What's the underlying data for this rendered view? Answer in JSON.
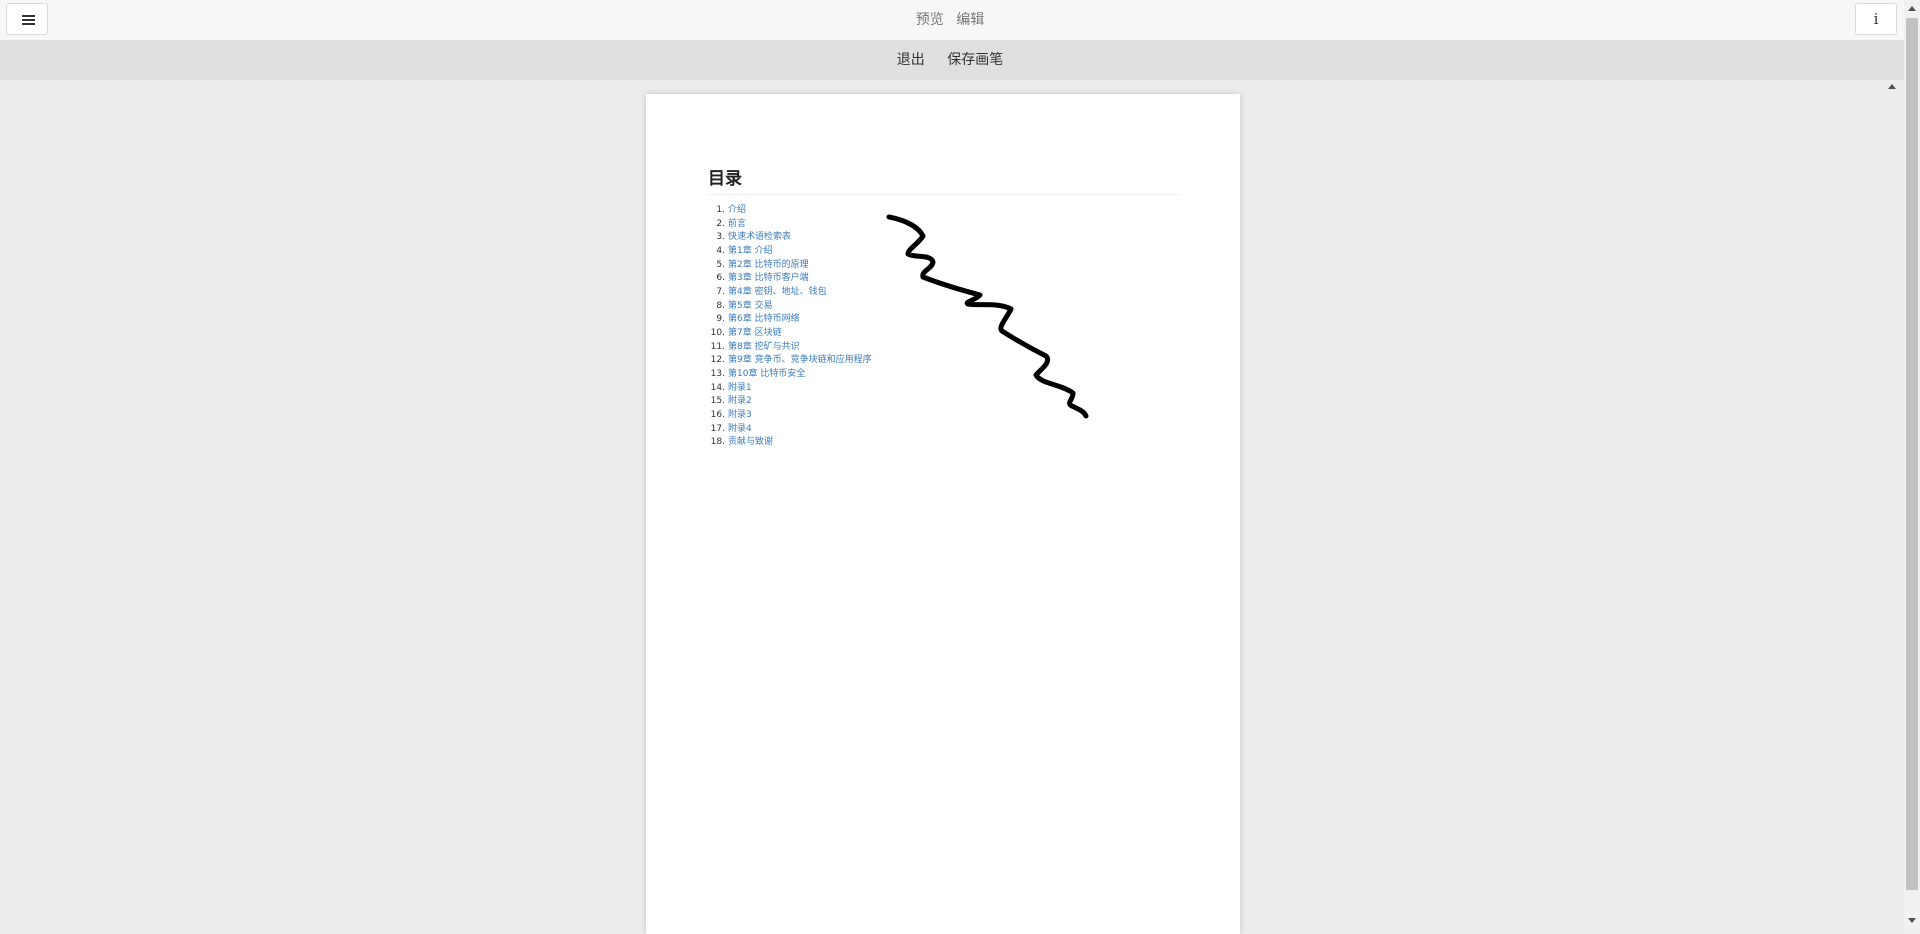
{
  "header": {
    "menu_icon": "hamburger-menu-icon",
    "tabs": [
      "预览",
      "编辑"
    ],
    "info_label": "i"
  },
  "toolbar": {
    "exit_label": "退出",
    "save_pen_label": "保存画笔"
  },
  "document": {
    "toc_title": "目录",
    "toc_items": [
      {
        "num": "1.",
        "label": "介绍"
      },
      {
        "num": "2.",
        "label": "前言"
      },
      {
        "num": "3.",
        "label": "快速术语检索表"
      },
      {
        "num": "4.",
        "label": "第1章 介绍"
      },
      {
        "num": "5.",
        "label": "第2章 比特币的原理"
      },
      {
        "num": "6.",
        "label": "第3章 比特币客户端"
      },
      {
        "num": "7.",
        "label": "第4章 密钥、地址、钱包"
      },
      {
        "num": "8.",
        "label": "第5章 交易"
      },
      {
        "num": "9.",
        "label": "第6章 比特币网络"
      },
      {
        "num": "10.",
        "label": "第7章 区块链"
      },
      {
        "num": "11.",
        "label": "第8章 挖矿与共识"
      },
      {
        "num": "12.",
        "label": "第9章 竞争币、竞争块链和应用程序"
      },
      {
        "num": "13.",
        "label": "第10章 比特币安全"
      },
      {
        "num": "14.",
        "label": "附录1"
      },
      {
        "num": "15.",
        "label": "附录2"
      },
      {
        "num": "16.",
        "label": "附录3"
      },
      {
        "num": "17.",
        "label": "附录4"
      },
      {
        "num": "18.",
        "label": "贡献与致谢"
      }
    ],
    "pen_stroke_color": "#000000"
  },
  "colors": {
    "link": "#3b7bbf",
    "toolbar_bg": "#e0e0e0",
    "workspace_bg": "#ededed"
  }
}
